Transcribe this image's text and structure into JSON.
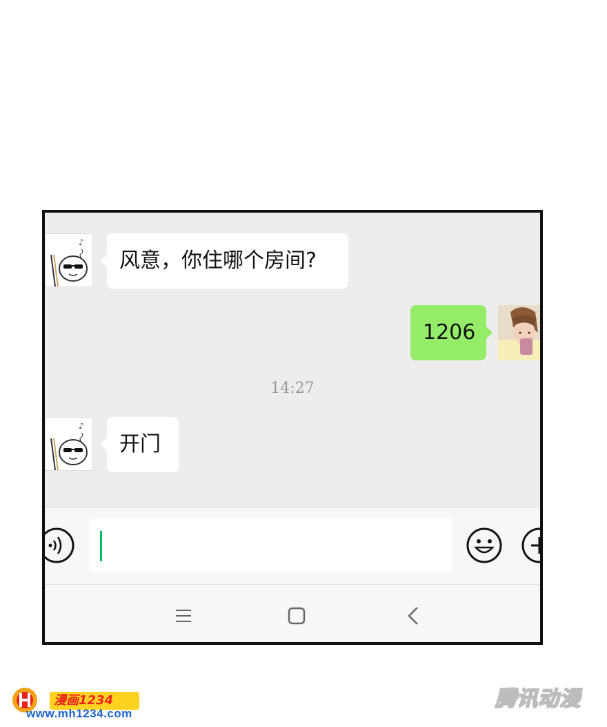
{
  "chat": {
    "messages": [
      {
        "direction": "incoming",
        "text": "风意，你住哪个房间?"
      },
      {
        "direction": "outgoing",
        "text": "1206"
      },
      {
        "direction": "incoming",
        "text": "开门"
      }
    ],
    "timestamp": "14:27"
  },
  "input_bar": {
    "voice_icon": "voice-icon",
    "emoji_icon": "emoji-icon",
    "plus_icon": "plus-icon",
    "value": ""
  },
  "nav_bar": {
    "icons": [
      "menu-icon",
      "home-icon",
      "back-icon"
    ]
  },
  "branding": {
    "logo_badge": "漫画1234",
    "logo_url": "www.mh1234.com",
    "watermark": "腾讯动漫"
  },
  "colors": {
    "outgoing_bubble": "#95ec69",
    "incoming_bubble": "#ffffff",
    "chat_background": "#ededed",
    "caret": "#07c160"
  }
}
